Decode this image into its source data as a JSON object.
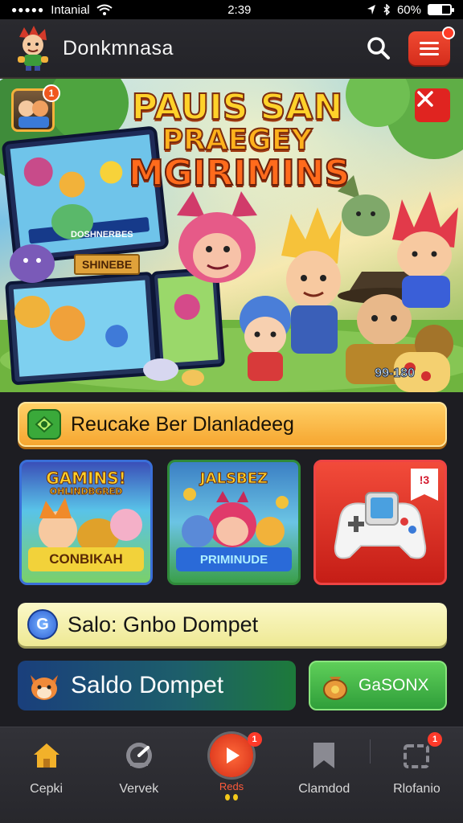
{
  "status_bar": {
    "carrier": "Intanial",
    "time": "2:39",
    "battery_percent": "60%",
    "battery_level": 0.6
  },
  "header": {
    "app_title": "Donkmnasa",
    "icons": [
      "search-icon",
      "menu-icon"
    ]
  },
  "hero": {
    "title_line1": "PAUIS SAN",
    "title_line2": "PRAEGEY",
    "title_line3": "MGIRIMINS",
    "avatar_badge": "1",
    "close_icon": "close-icon",
    "panel_label": "SHINEBE",
    "corner_text": "99-180",
    "inner_screen_label": "DOSHNERBES"
  },
  "reward_banner": {
    "text": "Reucake Ber Dlanladeeg",
    "icon": "gift-icon"
  },
  "game_cards": [
    {
      "title_top": "GAMINS!",
      "title_sub": "OHLINDBGRED",
      "footer": "CONBIKAH"
    },
    {
      "title_top": "JALSBEZ",
      "title_sub": "",
      "footer": "PRIMINUDE"
    },
    {
      "title_top": "",
      "title_sub": "",
      "footer": "",
      "ribbon": "!3"
    }
  ],
  "wallet_banner": {
    "text": "Salo: Gnbo Dompet",
    "icon_letter": "G"
  },
  "balance": {
    "label": "Saldo Dompet",
    "icon": "fox-icon"
  },
  "bonus_button": {
    "label": "GaSONX",
    "icon": "coin-bag-icon"
  },
  "bottom_nav": [
    {
      "label": "Cepki",
      "icon": "home-icon",
      "badge": ""
    },
    {
      "label": "Vervek",
      "icon": "gauge-icon",
      "badge": ""
    },
    {
      "label": "Reds",
      "icon": "play-icon",
      "badge": "1"
    },
    {
      "label": "Clamdod",
      "icon": "bookmark-icon",
      "badge": ""
    },
    {
      "label": "Rlofanio",
      "icon": "profile-icon",
      "badge": "1"
    }
  ],
  "colors": {
    "accent_red": "#e5341f",
    "accent_orange": "#f6a630",
    "accent_green": "#3aa93a"
  }
}
